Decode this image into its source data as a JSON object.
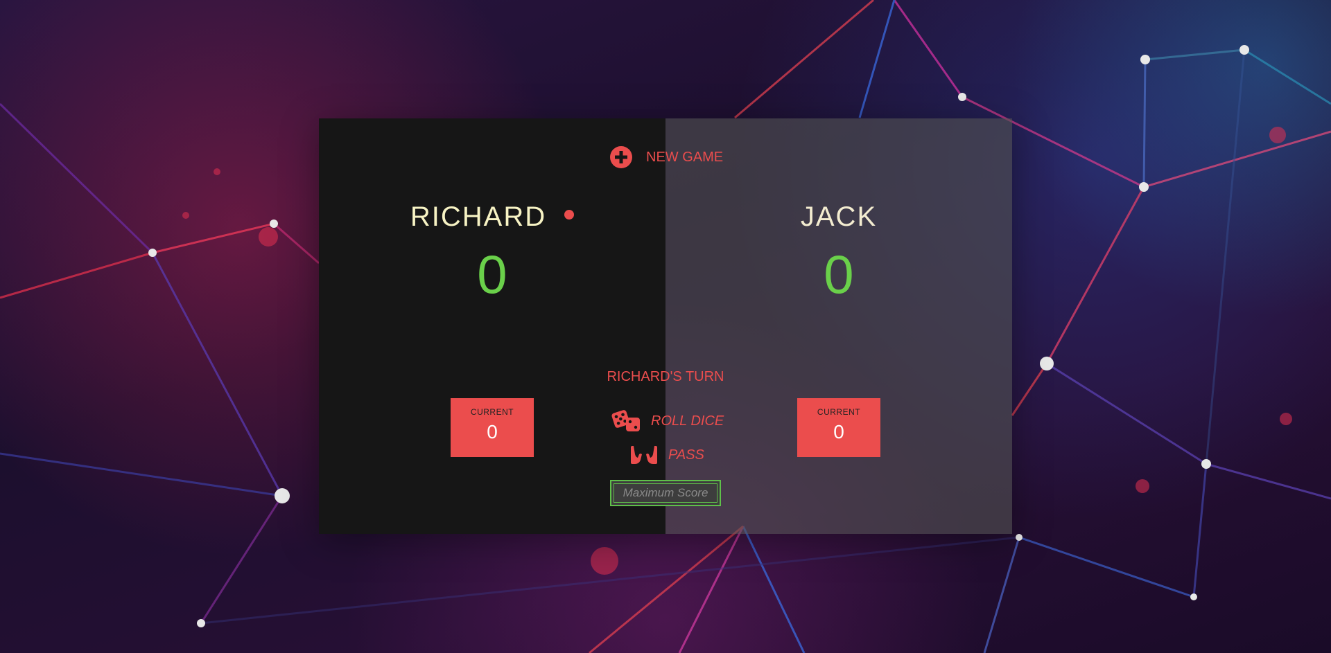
{
  "new_game": {
    "label": "NEW GAME",
    "icon": "plus-circle-icon"
  },
  "players": [
    {
      "name": "RICHARD",
      "score": "0",
      "current_label": "CURRENT",
      "current": "0",
      "active": true
    },
    {
      "name": "JACK",
      "score": "0",
      "current_label": "CURRENT",
      "current": "0",
      "active": false
    }
  ],
  "turn_text": "RICHARD'S TURN",
  "roll_dice": {
    "label": "ROLL DICE",
    "icon": "dice-icon"
  },
  "pass": {
    "label": "PASS",
    "icon": "hands-icon"
  },
  "max_score": {
    "placeholder": "Maximum Score",
    "value": ""
  },
  "colors": {
    "accent": "#eb4d4d",
    "score": "#6ad04a",
    "name": "#f7f3c4",
    "panel_active": "#161616",
    "panel_inactive": "#505050"
  }
}
